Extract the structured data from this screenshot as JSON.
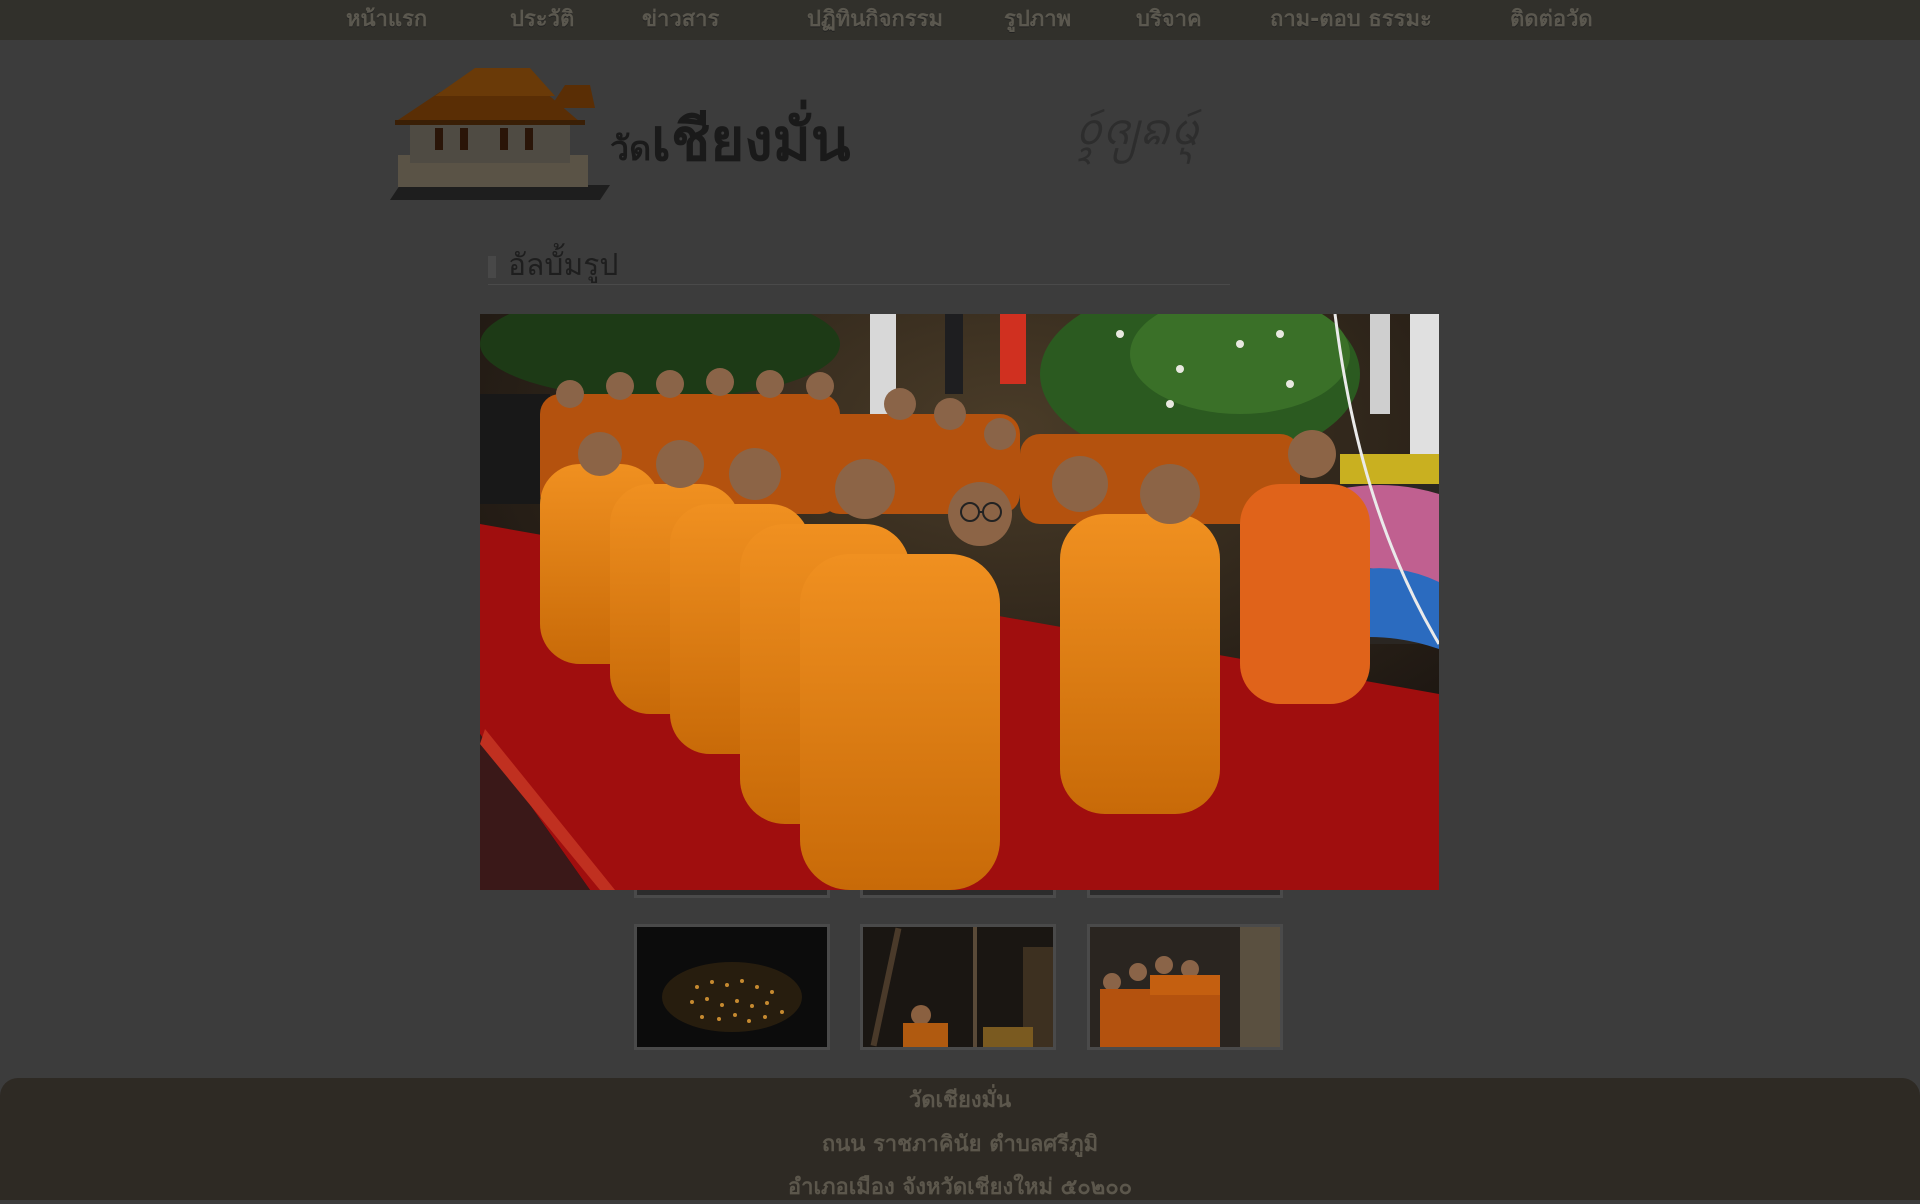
{
  "nav": {
    "items": [
      {
        "label": "หน้าแรก"
      },
      {
        "label": "ประวัติ"
      },
      {
        "label": "ข่าวสาร"
      },
      {
        "label": "ปฏิทินกิจกรรม"
      },
      {
        "label": "รูปภาพ"
      },
      {
        "label": "บริจาค"
      },
      {
        "label": "ถาม-ตอบ ธรรมะ"
      },
      {
        "label": "ติดต่อวัด"
      }
    ]
  },
  "header": {
    "logo_icon": "temple-icon",
    "title_prefix": "วัด",
    "title_main": "เชียงมั่น",
    "script_text": "ᩅᩢ᩠ᨯᨩ᩠ᨿᨦᨾᩢ᩠ᨶ"
  },
  "album": {
    "heading": "อัลบั้มรูป",
    "thumbnails": [
      {
        "name": "thumb-candles"
      },
      {
        "name": "thumb-monk-ceremony"
      },
      {
        "name": "thumb-monks-group"
      }
    ]
  },
  "lightbox": {
    "photo_desc_icon": "photo-monks-seated"
  },
  "footer": {
    "name": "วัดเชียงมั่น",
    "address_line1": "ถนน ราชภาคินัย ตำบลศรีภูมิ",
    "address_line2": "อำเภอเมือง จังหวัดเชียงใหม่ ๕๐๒๐๐"
  },
  "colors": {
    "nav_bg": "#31302b",
    "footer_bg": "#2e2a24",
    "robe": "#e07a10",
    "carpet": "#a80e0e"
  }
}
